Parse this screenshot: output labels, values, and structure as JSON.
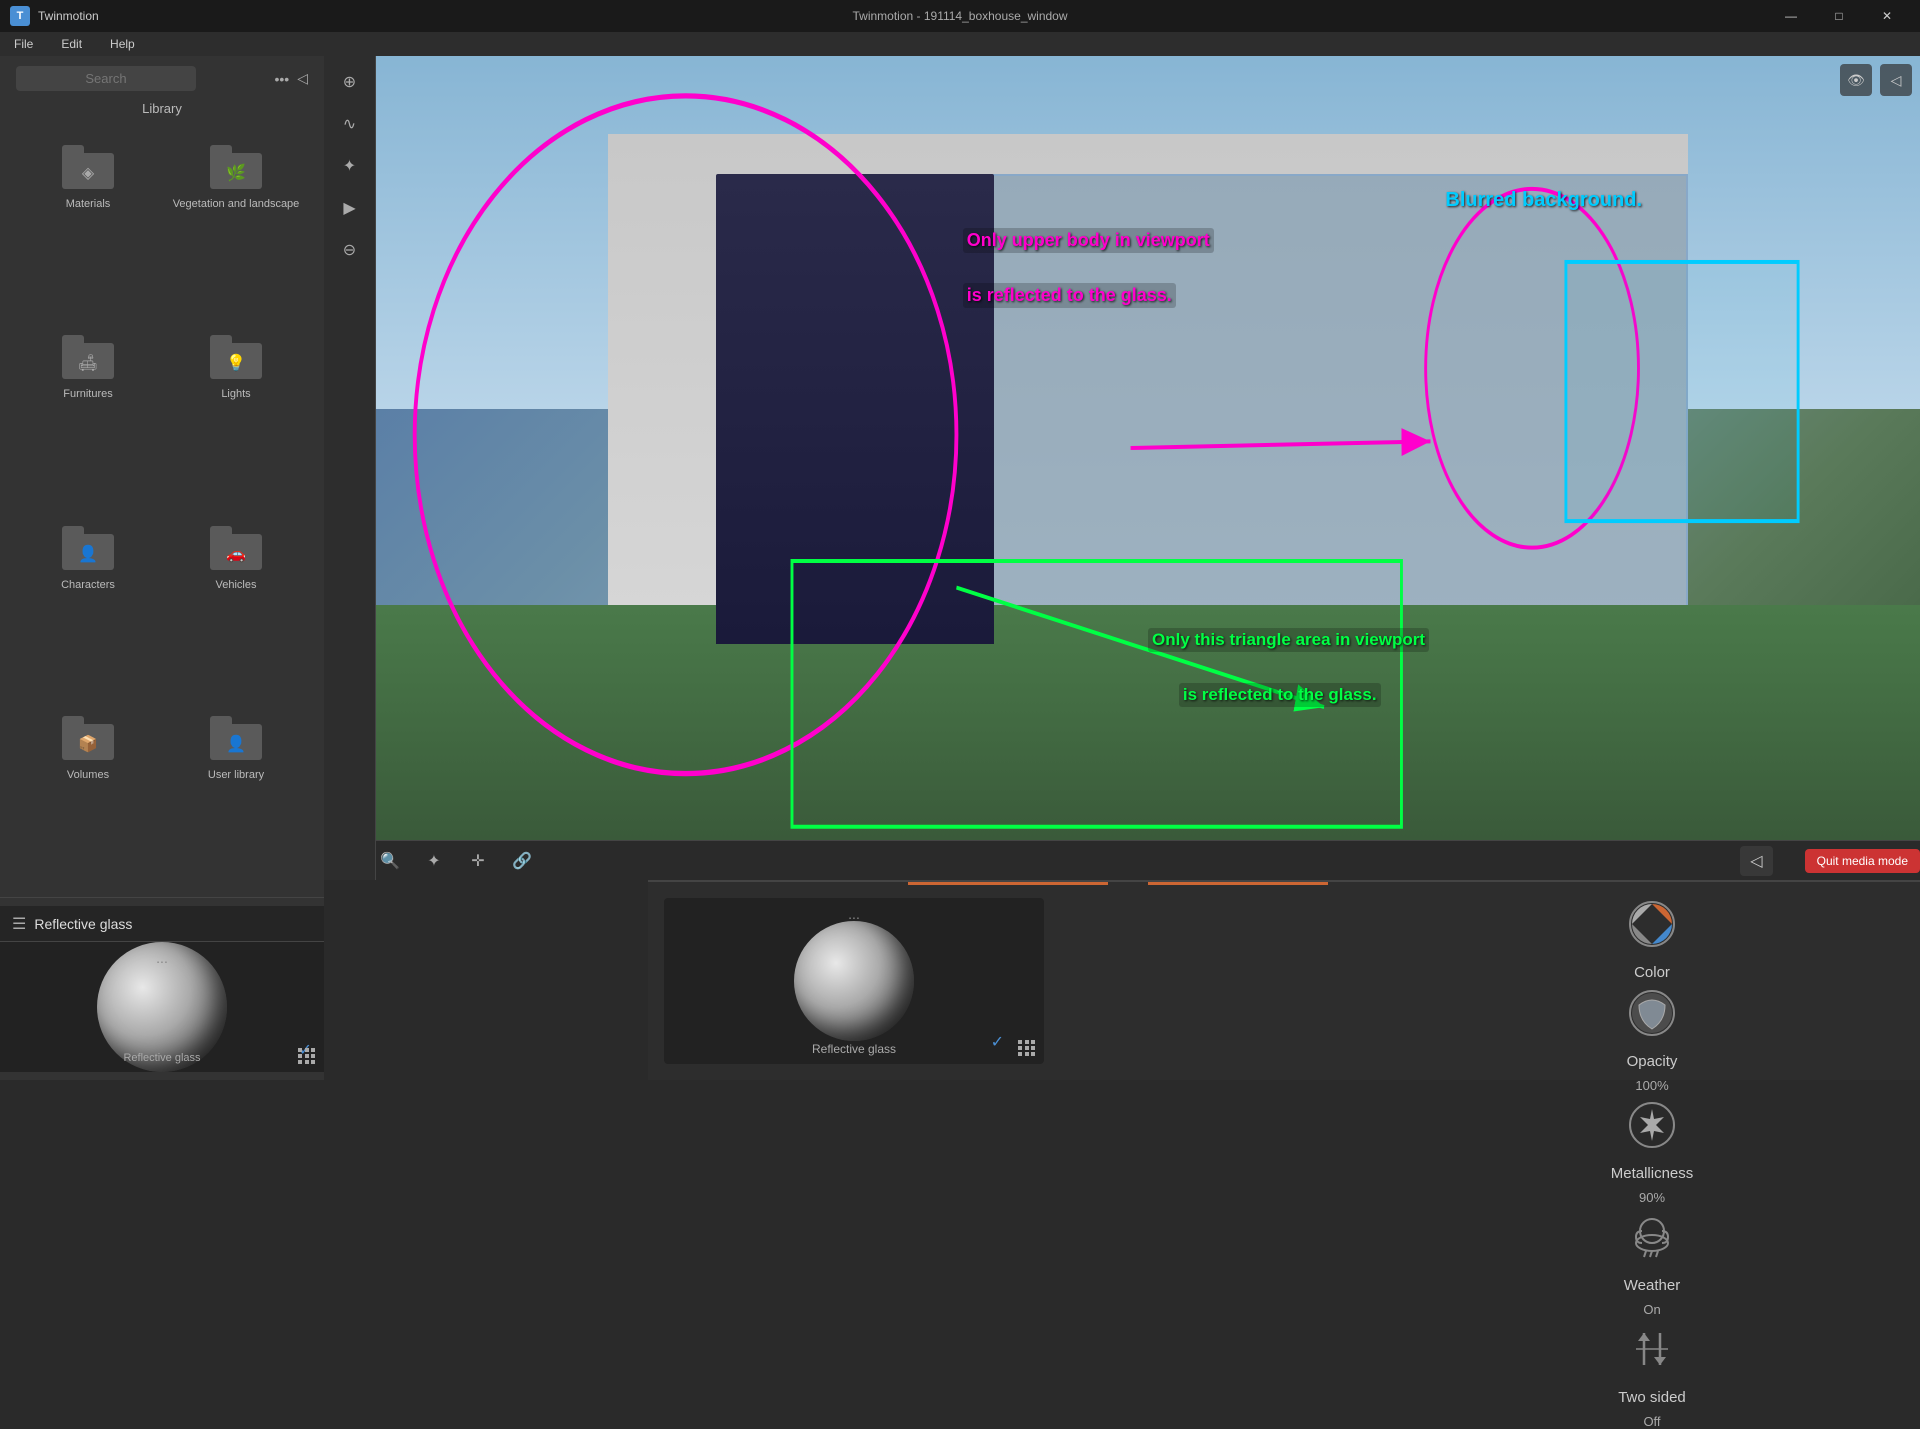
{
  "app": {
    "name": "Twinmotion",
    "icon_letter": "T"
  },
  "titlebar": {
    "window_title": "Twinmotion - 191114_boxhouse_window",
    "minimize_label": "—",
    "maximize_label": "□",
    "close_label": "✕"
  },
  "menubar": {
    "items": [
      "File",
      "Edit",
      "Help"
    ]
  },
  "sidebar": {
    "search_placeholder": "Search",
    "library_label": "Library",
    "library_items": [
      {
        "id": "materials",
        "label": "Materials",
        "symbol": "◈"
      },
      {
        "id": "vegetation",
        "label": "Vegetation and landscape",
        "symbol": "🌿"
      },
      {
        "id": "furnitures",
        "label": "Furnitures",
        "symbol": "⬛"
      },
      {
        "id": "lights",
        "label": "Lights",
        "symbol": "💡"
      },
      {
        "id": "characters",
        "label": "Characters",
        "symbol": "👤"
      },
      {
        "id": "vehicles",
        "label": "Vehicles",
        "symbol": "🚗"
      },
      {
        "id": "volumes",
        "label": "Volumes",
        "symbol": "⬡"
      },
      {
        "id": "user-library",
        "label": "User library",
        "symbol": "👤"
      }
    ]
  },
  "material": {
    "name": "Reflective glass",
    "preview_label": "Reflective glass",
    "preview_dots": "...",
    "check_mark": "✓"
  },
  "bottom_panel": {
    "header_icon": "☰",
    "material_name": "Reflective glass"
  },
  "viewport": {
    "title": "Twinmotion - 191114_boxhouse_window"
  },
  "annotations": {
    "pink_text_1": "Only upper body in viewport",
    "pink_text_2": "is reflected to the glass.",
    "cyan_text": "Blurred background.",
    "green_text_1": "Only this triangle area in viewport",
    "green_text_2": "is reflected to the glass."
  },
  "properties": {
    "color_label": "Color",
    "opacity_label": "Opacity",
    "opacity_value": "100%",
    "metallicness_label": "Metallicness",
    "metallicness_value": "90%",
    "weather_label": "Weather",
    "weather_value": "On",
    "two_sided_label": "Two sided",
    "two_sided_value": "Off"
  },
  "toolbar": {
    "quit_media_label": "Quit media mode"
  },
  "rail_icons": [
    "⊕",
    "∿",
    "✦",
    "▶",
    "⊖"
  ],
  "colors": {
    "accent_orange": "#cc6633",
    "accent_blue": "#4a8fd4",
    "accent_pink": "#ff00cc",
    "accent_green": "#00ff44",
    "accent_cyan": "#00ccff"
  }
}
